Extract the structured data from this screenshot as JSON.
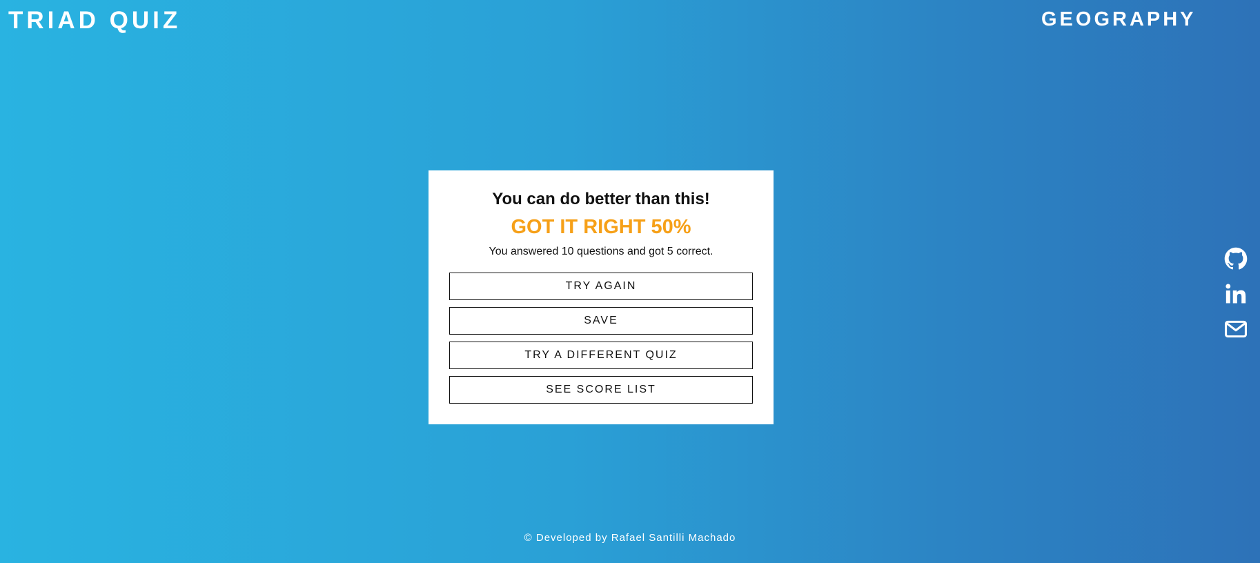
{
  "header": {
    "brand": "TRIAD QUIZ",
    "category": "GEOGRAPHY"
  },
  "result": {
    "heading": "You can do better than this!",
    "score": "GOT IT RIGHT 50%",
    "summary": "You answered 10 questions and got 5 correct."
  },
  "actions": {
    "try_again": "TRY AGAIN",
    "save": "SAVE",
    "different_quiz": "TRY A DIFFERENT QUIZ",
    "score_list": "SEE SCORE LIST"
  },
  "social": {
    "icons": [
      "github-icon",
      "linkedin-icon",
      "mail-icon"
    ]
  },
  "footer": {
    "text": "© Developed by Rafael Santilli Machado"
  },
  "colors": {
    "background_start": "#29b3e1",
    "background_end": "#2d72b8",
    "score": "#f6a018",
    "card": "#ffffff"
  }
}
